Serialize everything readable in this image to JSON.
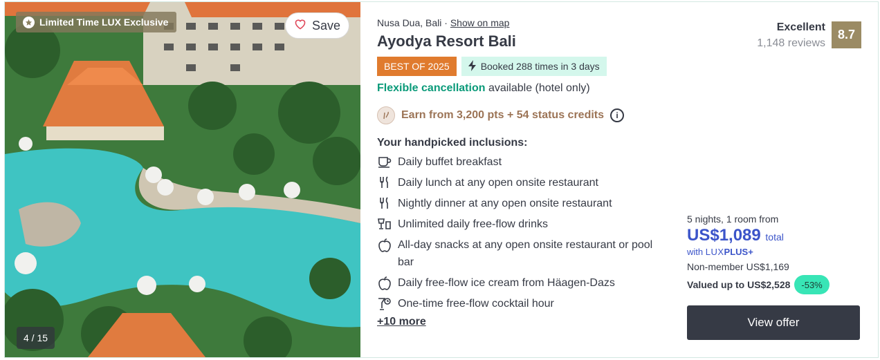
{
  "image": {
    "promo_badge": "Limited Time LUX Exclusive",
    "save_label": "Save",
    "counter": "4 / 15"
  },
  "hotel": {
    "location": "Nusa Dua, Bali",
    "location_sep": "·",
    "map_link": "Show on map",
    "name": "Ayodya Resort Bali",
    "best_badge": "BEST OF 2025",
    "booked_badge": "Booked 288 times in 3 days",
    "cancel_highlight": "Flexible cancellation",
    "cancel_rest": "available (hotel only)",
    "earn_text": "Earn from 3,200 pts + 54 status credits"
  },
  "rating": {
    "label": "Excellent",
    "reviews": "1,148 reviews",
    "score": "8.7"
  },
  "inclusions": {
    "heading": "Your handpicked inclusions:",
    "items": [
      {
        "icon": "coffee-cup-icon",
        "text": "Daily buffet breakfast"
      },
      {
        "icon": "fork-knife-icon",
        "text": "Daily lunch at any open onsite restaurant"
      },
      {
        "icon": "fork-knife-icon",
        "text": "Nightly dinner at any open onsite restaurant"
      },
      {
        "icon": "drinks-icon",
        "text": "Unlimited daily free-flow drinks"
      },
      {
        "icon": "apple-icon",
        "text": "All-day snacks at any open onsite restaurant or pool bar"
      },
      {
        "icon": "apple-icon",
        "text": "Daily free-flow ice cream from Häagen-Dazs"
      },
      {
        "icon": "cocktail-clock-icon",
        "text": "One-time free-flow cocktail hour"
      }
    ],
    "more": "+10 more"
  },
  "pricing": {
    "from": "5 nights, 1 room from",
    "amount": "US$1,089",
    "total": "total",
    "with": "with",
    "lux": "LUX",
    "plus": "PLUS+",
    "non_member": "Non-member US$1,169",
    "valued": "Valued up to US$2,528",
    "discount": "-53%",
    "cta": "View offer"
  },
  "colors": {
    "best_badge": "#e07b2e",
    "booked_badge": "#d4f7ec",
    "cancel_green": "#0a9a79",
    "earn_brown": "#9c7456",
    "price_blue": "#3b54c9",
    "discount_pill": "#38e5b6",
    "score_box": "#9b8b64",
    "cta_bg": "#363a45"
  }
}
